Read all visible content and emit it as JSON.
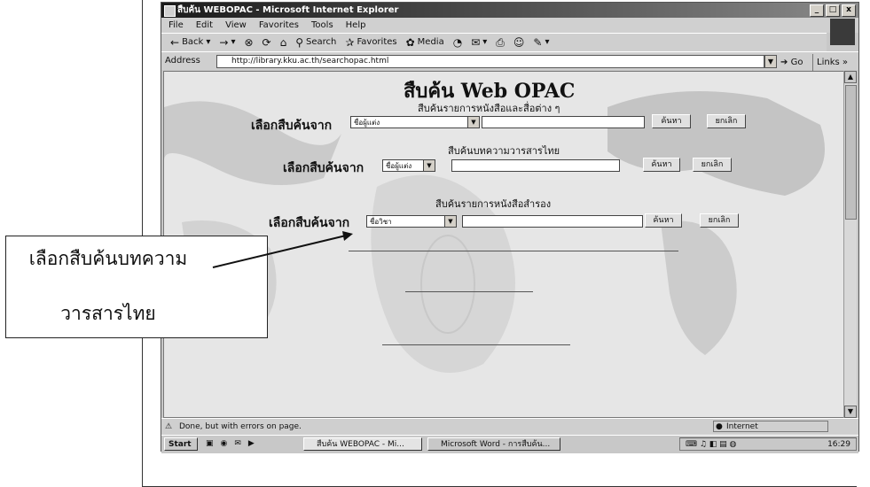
{
  "window": {
    "title": "สืบค้น WEBOPAC - Microsoft Internet Explorer",
    "controls": [
      "_",
      "□",
      "x"
    ]
  },
  "menu": [
    "File",
    "Edit",
    "View",
    "Favorites",
    "Tools",
    "Help"
  ],
  "toolbar": {
    "back": "Back",
    "forward": "→",
    "search": "Search",
    "favorites": "Favorites",
    "media": "Media"
  },
  "address": {
    "label": "Address",
    "url": "http://library.kku.ac.th/searchopac.html",
    "go": "Go",
    "links": "Links »"
  },
  "page": {
    "title": "สืบค้น Web OPAC",
    "sections": [
      {
        "subtitle": "สืบค้นรายการหนังสือและสื่อต่าง ๆ",
        "label": "เลือกสืบค้นจาก",
        "selected": "ชื่อผู้แต่ง",
        "search_btn": "ค้นหา",
        "cancel_btn": "ยกเลิก"
      },
      {
        "subtitle": "สืบค้นบทความวารสารไทย",
        "label": "เลือกสืบค้นจาก",
        "selected": "ชื่อผู้แต่ง",
        "search_btn": "ค้นหา",
        "cancel_btn": "ยกเลิก"
      },
      {
        "subtitle": "สืบค้นรายการหนังสือสำรอง",
        "label": "เลือกสืบค้นจาก",
        "selected": "ชื่อวิชา",
        "search_btn": "ค้นหา",
        "cancel_btn": "ยกเลิก"
      }
    ]
  },
  "status": {
    "text": "Done, but with errors on page.",
    "zone": "Internet"
  },
  "taskbar": {
    "start": "Start",
    "tasks": [
      "สืบค้น WEBOPAC - Mi...",
      "Microsoft Word - การสืบค้น..."
    ],
    "clock": "16:29"
  },
  "callout": {
    "line1": "เลือกสืบค้นบทความ",
    "line2": "วารสารไทย"
  }
}
